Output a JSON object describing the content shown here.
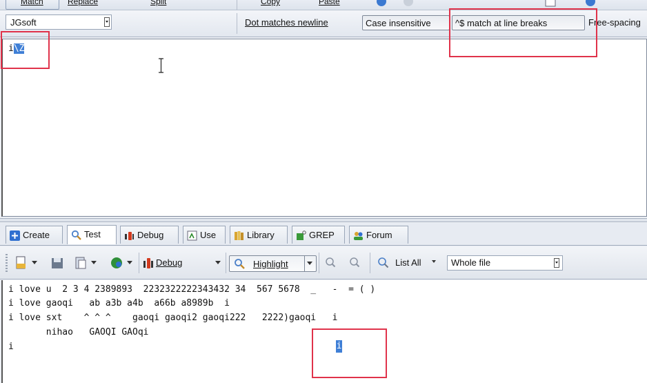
{
  "top_toolbar": {
    "match_label": "Match",
    "replace_label": "Replace",
    "split_label": "Split",
    "copy_label": "Copy",
    "paste_label": "Paste"
  },
  "flavor": {
    "selected": "JGsoft"
  },
  "options": {
    "dot_newline": "Dot matches newline",
    "case_insensitive": "Case insensitive",
    "multiline": "^$ match at line breaks",
    "free_spacing": "Free-spacing"
  },
  "regex": {
    "prefix": "i",
    "selected": "\\Z"
  },
  "tabs": [
    {
      "label": "Create"
    },
    {
      "label": "Test"
    },
    {
      "label": "Debug"
    },
    {
      "label": "Use"
    },
    {
      "label": "Library"
    },
    {
      "label": "GREP"
    },
    {
      "label": "Forum"
    }
  ],
  "test_toolbar": {
    "debug_label": "Debug",
    "highlight_label": "Highlight",
    "list_all_label": "List All",
    "scope_selected": "Whole file"
  },
  "subject_lines": [
    "i love u  2 3 4 2389893  2232322222343432 34  567 5678  _   -  = ( )",
    "i love gaoqi   ab a3b a4b  a66b a8989b  i",
    "i love sxt    ^ ^ ^    gaoqi gaoqi2 gaoqi222   2222)gaoqi   i",
    "       nihao   GAOQI GAOqi",
    "i"
  ],
  "match_highlight": "i",
  "colors": {
    "selection": "#3f7fd6",
    "annotation": "#e0324a"
  }
}
